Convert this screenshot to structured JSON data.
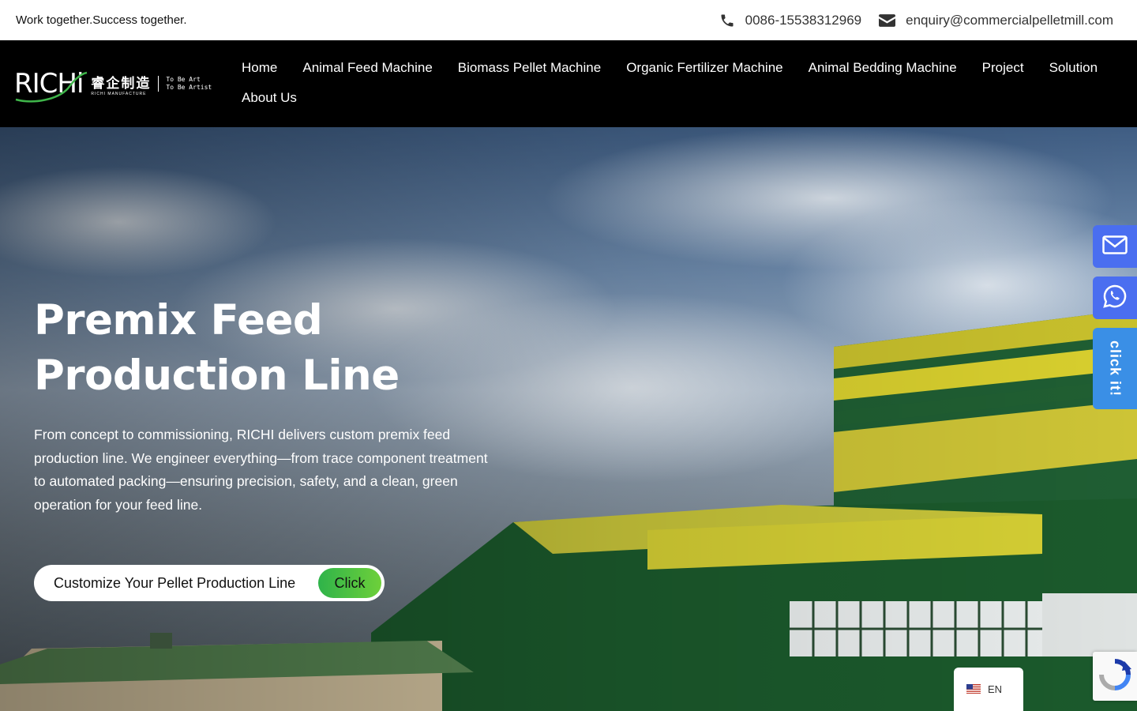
{
  "topbar": {
    "tagline": "Work together.Success together.",
    "phone": "0086-15538312969",
    "email": "enquiry@commercialpelletmill.com"
  },
  "logo": {
    "word": "RICHi",
    "cn": "睿企制造",
    "cn_sub": "RICHI MANUFACTURE",
    "art_line1": "To Be Art",
    "art_line2": "To Be Artist"
  },
  "nav": {
    "items": [
      {
        "label": "Home"
      },
      {
        "label": "Animal Feed Machine"
      },
      {
        "label": "Biomass Pellet Machine"
      },
      {
        "label": "Organic Fertilizer Machine"
      },
      {
        "label": "Animal Bedding Machine"
      },
      {
        "label": "Project"
      },
      {
        "label": "Solution"
      },
      {
        "label": "About Us"
      }
    ]
  },
  "hero": {
    "title": "Premix Feed Production Line",
    "description": "From concept to commissioning, RICHI delivers custom premix feed production line. We engineer everything—from trace component treatment to automated packing—ensuring precision, safety, and a clean, green operation for your feed line.",
    "cta_label": "Customize Your Pellet Production Line",
    "cta_pill": "Click"
  },
  "float": {
    "click_label": "click it!"
  },
  "language": {
    "code": "EN"
  },
  "colors": {
    "accent_blue": "#4a6ef0",
    "cta_green": "#2fb34a",
    "nav_bg": "#000000"
  }
}
